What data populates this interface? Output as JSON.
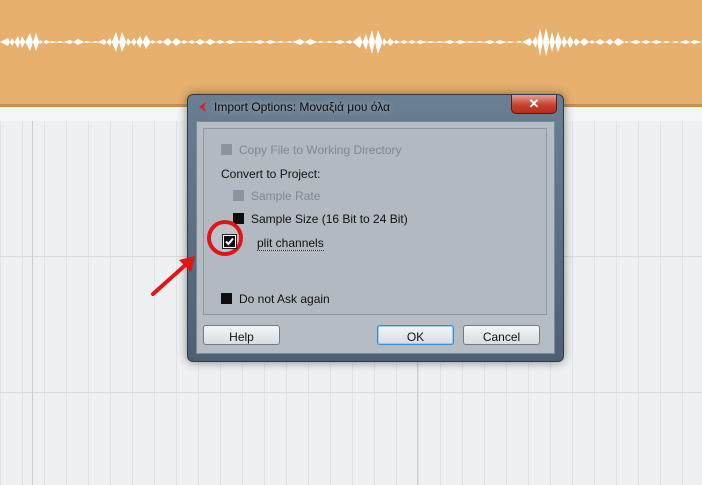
{
  "dialog": {
    "title": "Import Options: Μοναξιά μου όλα",
    "close_symbol": "✕",
    "options": {
      "copy_file": "Copy File to Working Directory",
      "convert_header": "Convert to Project:",
      "sample_rate": "Sample Rate",
      "sample_size": "Sample Size (16 Bit to 24 Bit)",
      "split_channels": "plit channels",
      "do_not_ask": "Do not Ask again"
    },
    "buttons": {
      "help": "Help",
      "ok": "OK",
      "cancel": "Cancel"
    },
    "states": {
      "copy_file": "disabled",
      "sample_rate": "disabled",
      "sample_size": "checked-black",
      "split_channels": "checked",
      "do_not_ask": "checked-black"
    }
  },
  "colors": {
    "track_bg": "#e8b06e",
    "annotation_red": "#e01616",
    "dialog_frame": "#5a6e82"
  },
  "icons": {
    "app_icon": "cubase-logo-icon",
    "checkmark": "checkmark-icon",
    "annotation_arrow": "red-arrow-icon"
  }
}
